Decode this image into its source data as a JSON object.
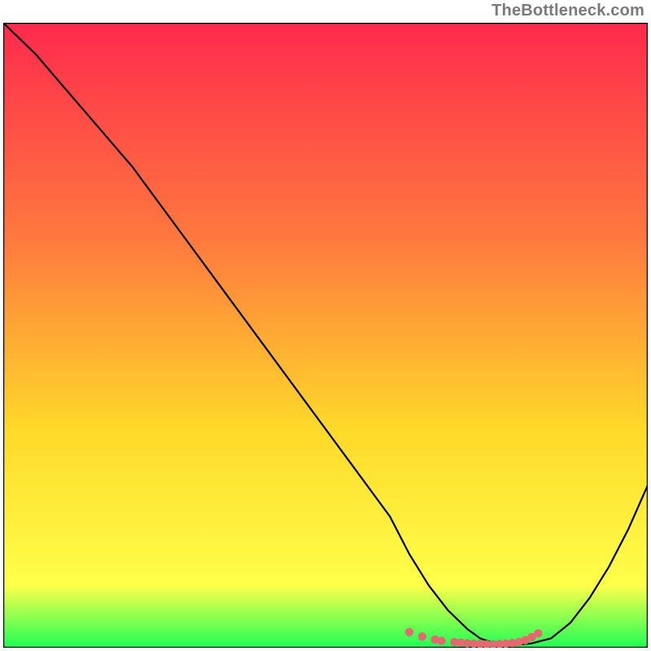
{
  "watermark": {
    "text": "TheBottleneck.com"
  },
  "colors": {
    "gradient_top": "#ff2a4d",
    "gradient_mid1": "#ff7a3e",
    "gradient_mid2": "#ffd92a",
    "gradient_mid3": "#ffff4a",
    "gradient_bottom": "#1fff55",
    "curve": "#000000",
    "markers": "#e06a6f",
    "border": "#000000"
  },
  "chart_data": {
    "type": "line",
    "title": "",
    "xlabel": "",
    "ylabel": "",
    "xlim": [
      0,
      100
    ],
    "ylim": [
      0,
      100
    ],
    "series": [
      {
        "name": "curve",
        "x": [
          0,
          5,
          10,
          15,
          20,
          25,
          30,
          35,
          40,
          45,
          50,
          55,
          60,
          63,
          66,
          69,
          72,
          74,
          76,
          78,
          80,
          82,
          85,
          88,
          91,
          94,
          97,
          100
        ],
        "values": [
          100,
          95,
          89,
          83,
          77,
          70,
          63,
          56,
          49,
          42,
          35,
          28,
          21,
          15,
          10,
          6,
          3,
          1.5,
          0.8,
          0.5,
          0.5,
          0.7,
          1.5,
          4,
          8,
          13,
          19,
          26
        ]
      }
    ],
    "markers": {
      "name": "bottom-band",
      "x": [
        63,
        65,
        67,
        68,
        70,
        71,
        72,
        73,
        74,
        75,
        76,
        77,
        78,
        79,
        80,
        81,
        82,
        83
      ],
      "values": [
        2.5,
        1.8,
        1.3,
        1.1,
        0.9,
        0.8,
        0.7,
        0.65,
        0.6,
        0.55,
        0.55,
        0.6,
        0.65,
        0.75,
        0.9,
        1.2,
        1.7,
        2.3
      ]
    },
    "green_band_top": 3.0
  }
}
